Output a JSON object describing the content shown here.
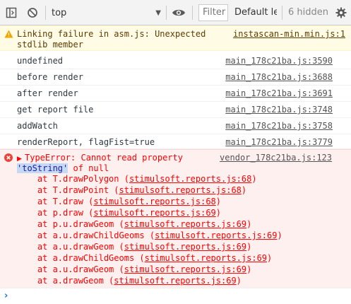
{
  "toolbar": {
    "context": "top",
    "filter_placeholder": "Filter",
    "level": "Default le",
    "hidden": "6 hidden"
  },
  "warning": {
    "line1": "Linking failure in asm.js: Unexpected",
    "line2": "stdlib member",
    "source": "instascan-min.min.js:1"
  },
  "logs": [
    {
      "text": "undefined",
      "source": "main_178c21ba.js:3590"
    },
    {
      "text": "before render",
      "source": "main_178c21ba.js:3688"
    },
    {
      "text": "after render",
      "source": "main_178c21ba.js:3691"
    },
    {
      "text": "get report file",
      "source": "main_178c21ba.js:3748"
    },
    {
      "text": "addWatch",
      "source": "main_178c21ba.js:3758"
    },
    {
      "text": "renderReport, flagFist=true",
      "source": "main_178c21ba.js:3779"
    }
  ],
  "error": {
    "line1": "TypeError: Cannot read property",
    "highlight": "'toString'",
    "line2_rest": " of null",
    "source": "vendor_178c21ba.js:123",
    "stack": [
      {
        "prefix": "    at T.drawPolygon (",
        "link": "stimulsoft.reports.js:68",
        "suffix": ")"
      },
      {
        "prefix": "    at T.drawPoint (",
        "link": "stimulsoft.reports.js:68",
        "suffix": ")"
      },
      {
        "prefix": "    at T.draw (",
        "link": "stimulsoft.reports.js:68",
        "suffix": ")"
      },
      {
        "prefix": "    at p.draw (",
        "link": "stimulsoft.reports.js:69",
        "suffix": ")"
      },
      {
        "prefix": "    at p.u.drawGeom (",
        "link": "stimulsoft.reports.js:69",
        "suffix": ")"
      },
      {
        "prefix": "    at a.u.drawChildGeoms (",
        "link": "stimulsoft.reports.js:69",
        "suffix": ")"
      },
      {
        "prefix": "    at a.u.drawGeom (",
        "link": "stimulsoft.reports.js:69",
        "suffix": ")"
      },
      {
        "prefix": "    at a.drawChildGeoms (",
        "link": "stimulsoft.reports.js:69",
        "suffix": ")"
      },
      {
        "prefix": "    at a.u.drawGeom (",
        "link": "stimulsoft.reports.js:69",
        "suffix": ")"
      },
      {
        "prefix": "    at a.drawGeom (",
        "link": "stimulsoft.reports.js:69",
        "suffix": ")"
      }
    ]
  },
  "colors": {
    "error_red": "#ff0000",
    "warning_bg": "#fffbe5",
    "error_bg": "#fff0f0",
    "prompt_blue": "#1a73e8"
  },
  "icons": [
    "sidebar-toggle-icon",
    "clear-console-icon",
    "eye-icon",
    "settings-gear-icon",
    "warning-icon",
    "error-icon",
    "expand-triangle-icon",
    "prompt-chevron-icon"
  ]
}
